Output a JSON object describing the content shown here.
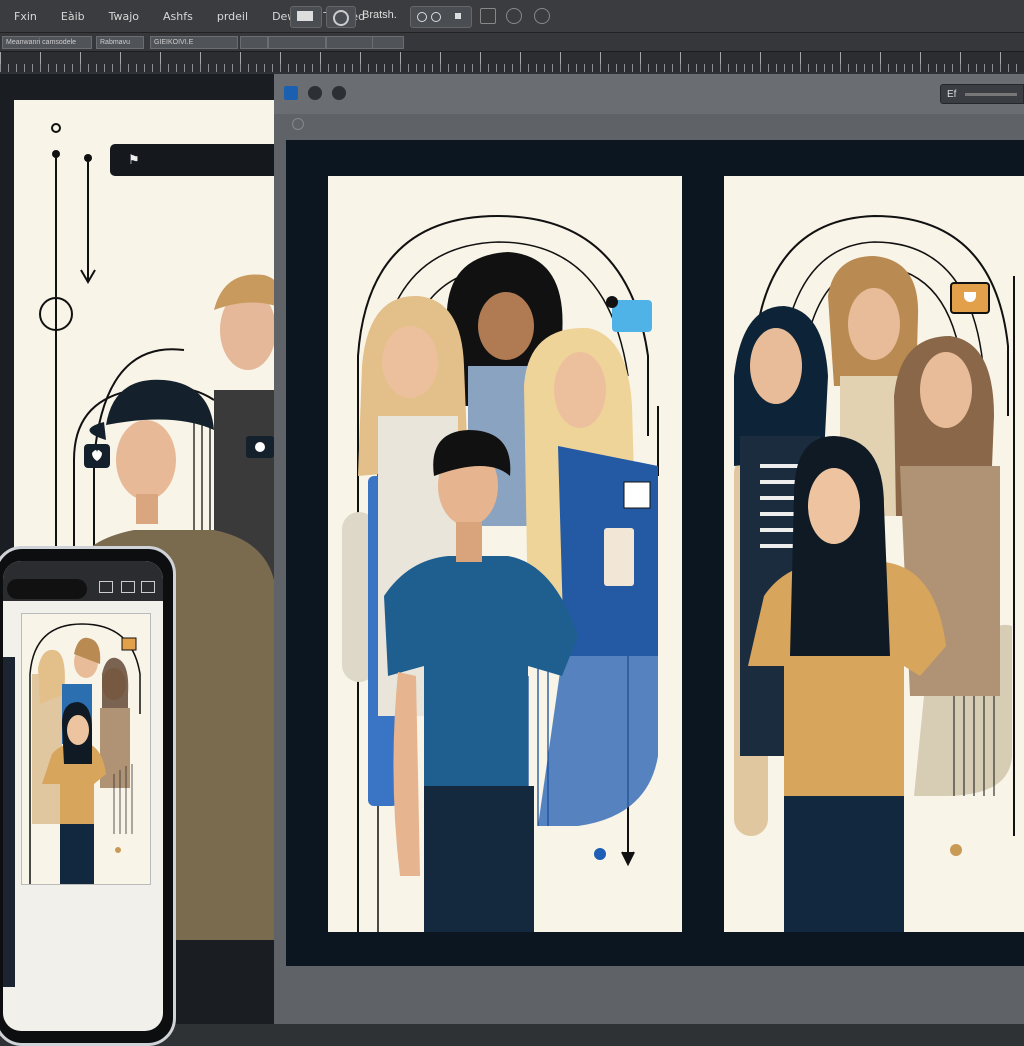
{
  "menubar": {
    "items": [
      "Fxin",
      "Eàib",
      "Twajo",
      "Ashfs",
      "prdeil",
      "Dewl",
      "Texsred"
    ],
    "tools_label": "Bratsh."
  },
  "optionbar": {
    "segments": [
      "Meanwanri camsodele",
      "Rabmavu",
      "GIEIKOIVI.E",
      "",
      " ",
      "",
      ""
    ]
  },
  "back_document": {
    "field_glyph": "⚑"
  },
  "main_window": {
    "zoom_label": "Ef"
  },
  "colors": {
    "accent_blue": "#2c6fb0",
    "navy": "#0b1620",
    "cream": "#f8f4e8",
    "mustard": "#c89a55",
    "chrome": "#3a3c3f"
  },
  "icons": [
    "traffic-light-icon",
    "heart-icon",
    "chat-bubble-icon",
    "camera-icon",
    "arrow-down-icon",
    "zoom-icon"
  ]
}
